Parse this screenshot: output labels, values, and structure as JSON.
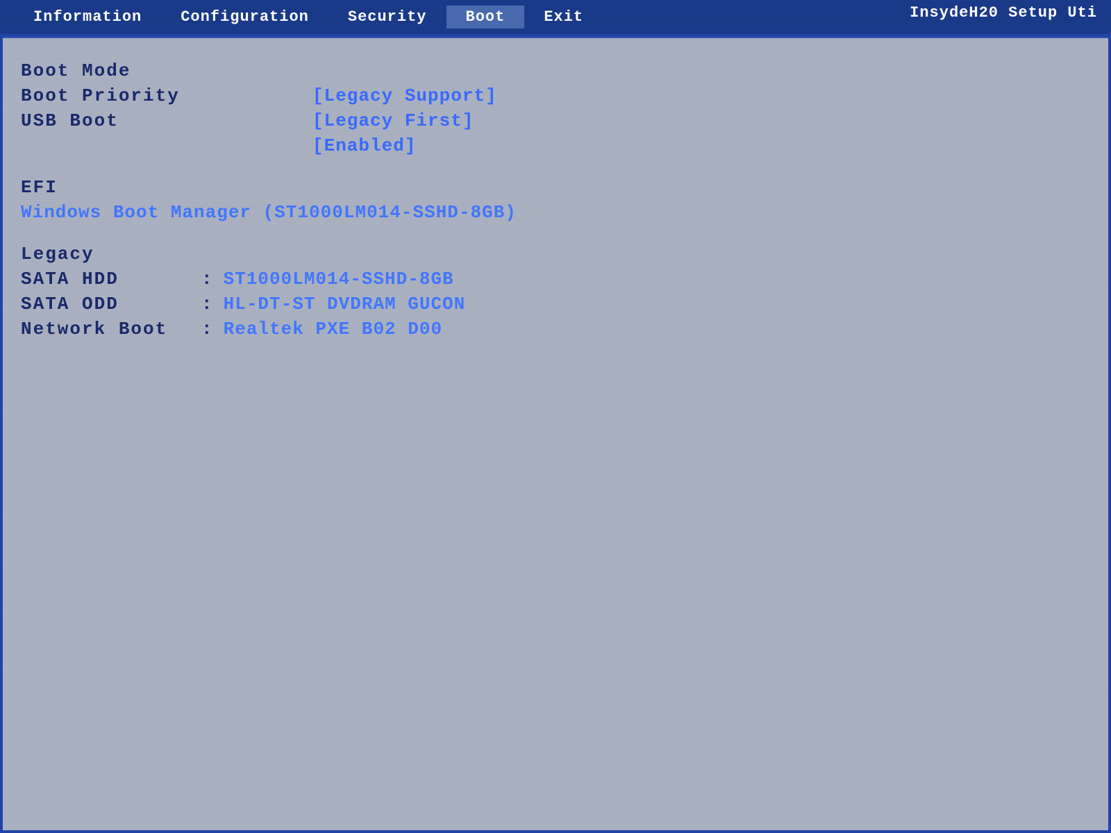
{
  "header": {
    "title": "InsydeH20 Setup Uti",
    "menu_items": [
      {
        "label": "Information",
        "active": false
      },
      {
        "label": "Configuration",
        "active": false
      },
      {
        "label": "Security",
        "active": false
      },
      {
        "label": "Boot",
        "active": true
      },
      {
        "label": "Exit",
        "active": false
      }
    ]
  },
  "boot_section": {
    "rows": [
      {
        "label": "Boot Mode",
        "value": ""
      },
      {
        "label": "Boot Priority",
        "value": "[Legacy Support]"
      },
      {
        "label": "USB Boot",
        "value": "[Legacy First]"
      },
      {
        "label": "",
        "value": "[Enabled]"
      }
    ]
  },
  "efi_section": {
    "heading": "EFI",
    "entry": "Windows Boot Manager (ST1000LM014-SSHD-8GB)"
  },
  "legacy_section": {
    "heading": "Legacy",
    "rows": [
      {
        "key": "SATA HDD",
        "colon": ":",
        "value": "ST1000LM014-SSHD-8GB"
      },
      {
        "key": "SATA ODD",
        "colon": ":",
        "value": "HL-DT-ST DVDRAM GUCON"
      },
      {
        "key": "Network Boot",
        "colon": ":",
        "value": "Realtek PXE B02 D00"
      }
    ]
  }
}
